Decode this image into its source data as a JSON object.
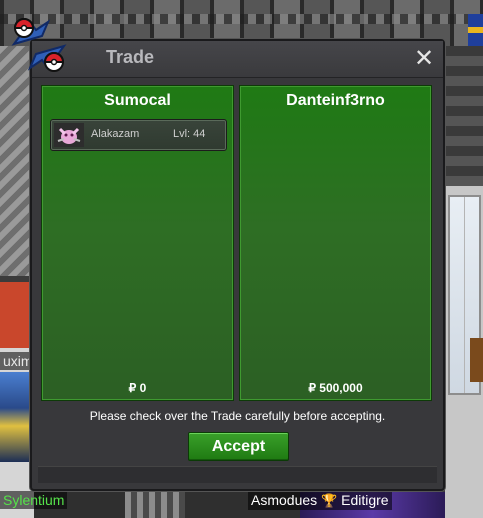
{
  "window": {
    "title": "Trade",
    "close_symbol": "✕",
    "logo_icon": "trade-arrows-pokeball-icon"
  },
  "left_player": {
    "name": "Sumocal",
    "money": "₽ 0",
    "items": [
      {
        "icon": "alakazam-sprite-icon",
        "name": "Alakazam",
        "level": "Lvl: 44"
      }
    ]
  },
  "right_player": {
    "name": "Danteinf3rno",
    "money": "₽ 500,000",
    "items": []
  },
  "notice": "Please check over the Trade carefully before accepting.",
  "accept_label": "Accept",
  "world": {
    "name_tags": {
      "green": "Sylentium",
      "white": "Asmodues",
      "trophy_name": "Editigre",
      "partial": "uxima"
    }
  },
  "colors": {
    "panel_green": "#2e6e24",
    "accept_green": "#2a8c1c",
    "window_bg": "#38383b",
    "name_green": "#56e24a"
  }
}
